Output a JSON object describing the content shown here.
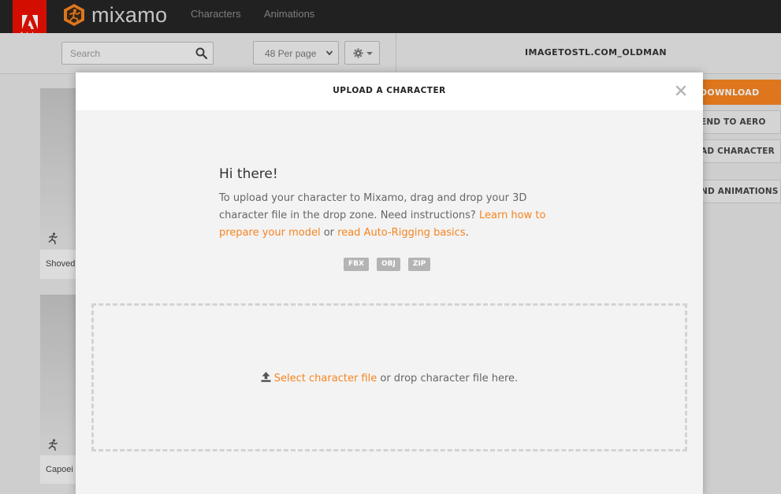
{
  "header": {
    "adobe_label": "Adobe",
    "brand_name": "mixamo",
    "nav": [
      {
        "label": "Characters"
      },
      {
        "label": "Animations"
      }
    ]
  },
  "toolbar": {
    "search_placeholder": "Search",
    "per_page": "48 Per page",
    "character_name": "IMAGETOSTL.COM_OLDMAN"
  },
  "cards": [
    {
      "label": "Shoved"
    },
    {
      "label": "Capoei"
    }
  ],
  "right_panel": {
    "download": "DOWNLOAD",
    "send_to_aero": "END TO AERO",
    "upload_character": "AD CHARACTER",
    "find_animations": "ND ANIMATIONS"
  },
  "modal": {
    "title": "UPLOAD A CHARACTER",
    "greeting": "Hi there!",
    "intro_text": "To upload your character to Mixamo, drag and drop your 3D character file in the drop zone. Need instructions?",
    "link_prepare": "Learn how to prepare your model",
    "or_text": "or",
    "link_rigging": "read Auto-Rigging basics",
    "period": ".",
    "formats": [
      "FBX",
      "OBJ",
      "ZIP"
    ],
    "select_link": "Select character file",
    "drop_text": "or drop character file here."
  },
  "colors": {
    "accent": "#f68420",
    "adobe_red": "#eb1000",
    "topbar": "#252525"
  }
}
